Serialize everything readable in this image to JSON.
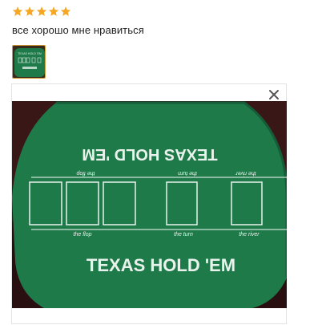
{
  "review": {
    "rating": 5,
    "rating_max": 5,
    "star_color": "#f5a623",
    "text": "все хорошо мне нравиться"
  },
  "photo": {
    "felt_color": "#1f7a4a",
    "title_top": "TEXAS HOLD 'EM",
    "title_bottom": "TEXAS HOLD 'EM",
    "label_flop": "the flop",
    "label_turn": "the turn",
    "label_river": "the river",
    "label_flop_top": "the flop",
    "label_turn_top": "the turn",
    "label_river_top": "the river",
    "thumb_title": "TEXAS HOLD 'EM"
  },
  "viewer": {
    "close_icon": "close-icon"
  }
}
